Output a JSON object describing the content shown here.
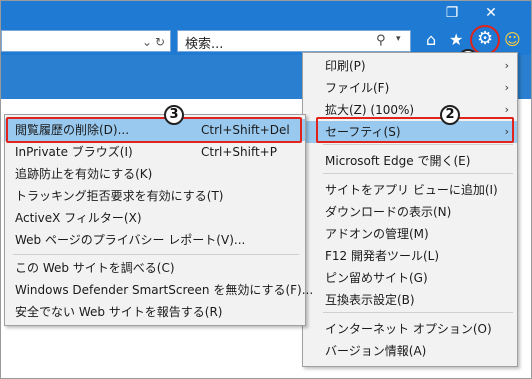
{
  "browser": {
    "window_controls": {
      "restore": "❐",
      "close": "✕"
    },
    "address": {
      "refresh_glyph": "↻",
      "dropdown_glyph": "⌄"
    },
    "search": {
      "placeholder": "検索...",
      "search_glyph": "⚲",
      "dropdown_glyph": "▾"
    },
    "toolbar": {
      "home_glyph": "⌂",
      "favorites_glyph": "★",
      "tools_glyph": "⚙",
      "smiley_glyph": "☺"
    }
  },
  "tools_menu": {
    "items": [
      {
        "label": "印刷(P)",
        "has_submenu": true
      },
      {
        "label": "ファイル(F)",
        "has_submenu": true
      },
      {
        "label": "拡大(Z) (100%)",
        "has_submenu": true
      },
      {
        "label": "セーフティ(S)",
        "has_submenu": true,
        "highlighted": true
      },
      {
        "label": "Microsoft Edge で開く(E)",
        "has_submenu": false
      },
      {
        "label": "サイトをアプリ ビューに追加(I)",
        "has_submenu": false
      },
      {
        "label": "ダウンロードの表示(N)",
        "has_submenu": false
      },
      {
        "label": "アドオンの管理(M)",
        "has_submenu": false
      },
      {
        "label": "F12 開発者ツール(L)",
        "has_submenu": false
      },
      {
        "label": "ピン留めサイト(G)",
        "has_submenu": false
      },
      {
        "label": "互換表示設定(B)",
        "has_submenu": false
      },
      {
        "label": "インターネット オプション(O)",
        "has_submenu": false
      },
      {
        "label": "バージョン情報(A)",
        "has_submenu": false
      }
    ],
    "arrow_glyph": "›"
  },
  "safety_menu": {
    "items": [
      {
        "label": "閲覧履歴の削除(D)...",
        "shortcut": "Ctrl+Shift+Del",
        "highlighted": true
      },
      {
        "label": "InPrivate ブラウズ(I)",
        "shortcut": "Ctrl+Shift+P"
      },
      {
        "label": "追跡防止を有効にする(K)",
        "shortcut": ""
      },
      {
        "label": "トラッキング拒否要求を有効にする(T)",
        "shortcut": ""
      },
      {
        "label": "ActiveX フィルター(X)",
        "shortcut": ""
      },
      {
        "label": "Web ページのプライバシー レポート(V)...",
        "shortcut": ""
      },
      {
        "label": "この Web サイトを調べる(C)",
        "shortcut": ""
      },
      {
        "label": "Windows Defender SmartScreen を無効にする(F)...",
        "shortcut": ""
      },
      {
        "label": "安全でない Web サイトを報告する(R)",
        "shortcut": ""
      }
    ]
  },
  "callouts": {
    "step1": "1",
    "step2": "2",
    "step3": "3"
  },
  "colors": {
    "chrome_blue": "#1e7ad3",
    "highlight": "#99c9ef",
    "callout_red": "#e0231b",
    "menu_bg": "#f2f2f2"
  }
}
